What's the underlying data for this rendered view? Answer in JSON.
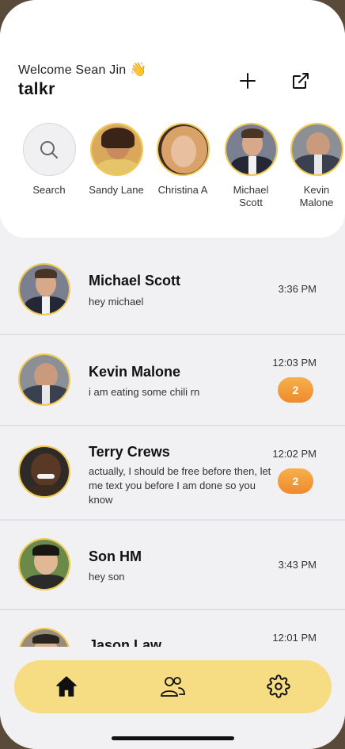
{
  "header": {
    "welcome": "Welcome Sean Jin",
    "wave": "👋",
    "title": "talkr"
  },
  "stories": [
    {
      "label": "Search"
    },
    {
      "label": "Sandy Lane"
    },
    {
      "label": "Christina A"
    },
    {
      "label": "Michael Scott"
    },
    {
      "label": "Kevin Malone"
    }
  ],
  "chats": [
    {
      "name": "Michael Scott",
      "message": "hey michael",
      "time": "3:36 PM",
      "unread": ""
    },
    {
      "name": "Kevin Malone",
      "message": "i am eating some chili rn",
      "time": "12:03 PM",
      "unread": "2"
    },
    {
      "name": "Terry Crews",
      "message": "actually, I should be free before then, let me text you before I am done so you know",
      "time": "12:02 PM",
      "unread": "2"
    },
    {
      "name": "Son HM",
      "message": "hey son",
      "time": "3:43 PM",
      "unread": ""
    },
    {
      "name": "Jason Law",
      "message": "",
      "time": "12:01 PM",
      "unread": ""
    }
  ],
  "colors": {
    "accent": "#f2c94c",
    "tabbar": "#f6dc82",
    "badge": "#ef8a2d"
  },
  "tabs": [
    {
      "icon": "home-icon"
    },
    {
      "icon": "people-icon"
    },
    {
      "icon": "gear-icon"
    }
  ]
}
